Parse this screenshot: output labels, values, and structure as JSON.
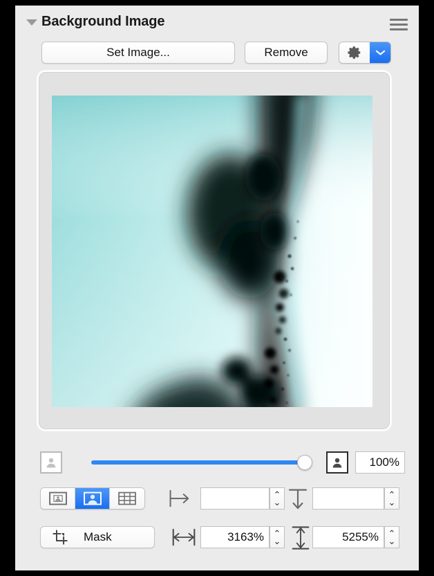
{
  "panel": {
    "title": "Background Image",
    "disclosure_icon": "triangle-down-icon",
    "menu_icon": "hamburger-menu-icon"
  },
  "toolbar": {
    "set_image_label": "Set Image...",
    "remove_label": "Remove",
    "gear_icon": "gear-icon",
    "chevron_icon": "chevron-down-icon",
    "accent_color": "#1a6ef0"
  },
  "preview": {
    "image_description": "blurred abstract cyan and black droplet photograph",
    "background_color": "#eafcfc"
  },
  "opacity": {
    "min_icon": "person-faded-icon",
    "max_icon": "person-solid-icon",
    "value": "100%",
    "slider_percent": 100,
    "track_color": "#2f87f2"
  },
  "scaling": {
    "segments": [
      {
        "name": "scale-to-fit",
        "icon": "image-small-in-frame-icon",
        "selected": false
      },
      {
        "name": "scale-to-fill",
        "icon": "image-large-in-frame-icon",
        "selected": true
      },
      {
        "name": "tile",
        "icon": "grid-tile-icon",
        "selected": false
      }
    ]
  },
  "offset": {
    "horizontal_icon": "offset-right-arrow-icon",
    "horizontal_value": "",
    "horizontal_placeholder": "",
    "vertical_icon": "offset-down-arrow-icon",
    "vertical_value": "",
    "vertical_placeholder": ""
  },
  "size": {
    "mask_label": "Mask",
    "mask_icon": "crop-mask-icon",
    "width_icon": "width-arrows-icon",
    "width_value": "3163%",
    "height_icon": "height-arrows-icon",
    "height_value": "5255%"
  },
  "stepper": {
    "up_glyph": "⌃",
    "down_glyph": "⌄"
  }
}
